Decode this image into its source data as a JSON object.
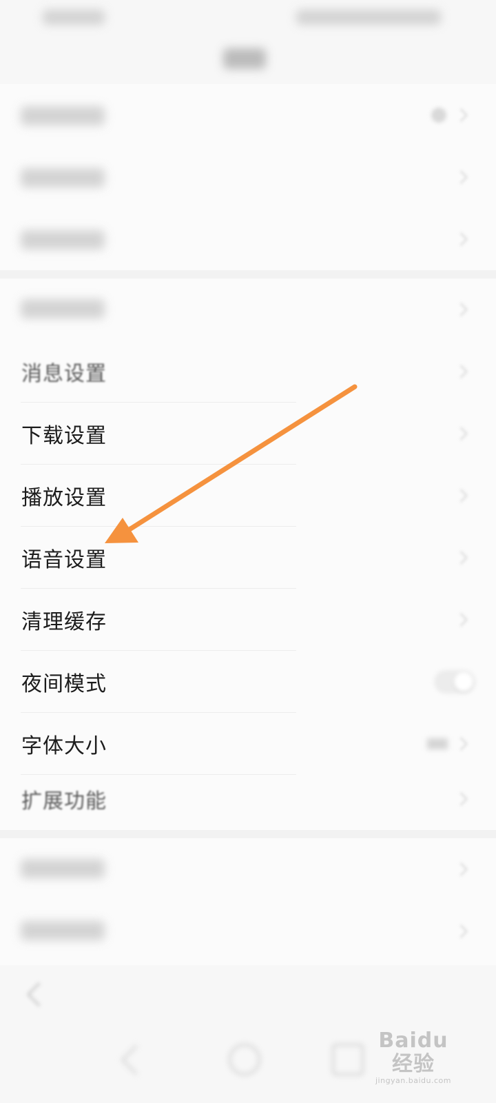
{
  "settings": {
    "section_1": [
      {
        "label": "",
        "blurred": true,
        "trailing": "badge"
      },
      {
        "label": "",
        "blurred": true,
        "trailing": "chevron"
      },
      {
        "label": "",
        "blurred": true,
        "trailing": "chevron"
      }
    ],
    "section_2": [
      {
        "label": "",
        "blurred": true,
        "trailing": "chevron"
      },
      {
        "label": "消息设置",
        "trailing": "chevron"
      },
      {
        "label": "下载设置",
        "trailing": "chevron"
      },
      {
        "label": "播放设置",
        "trailing": "chevron"
      },
      {
        "label": "语音设置",
        "trailing": "chevron"
      },
      {
        "label": "清理缓存",
        "trailing": "chevron"
      },
      {
        "label": "夜间模式",
        "trailing": "toggle",
        "toggle_on": false
      },
      {
        "label": "字体大小",
        "trailing": "value"
      },
      {
        "label": "扩展功能",
        "trailing": "chevron"
      }
    ],
    "section_3": [
      {
        "label": "",
        "blurred": true,
        "trailing": "chevron"
      },
      {
        "label": "",
        "blurred": true,
        "trailing": "chevron"
      }
    ]
  },
  "annotation": {
    "color": "#f5923e",
    "points_to": "语音设置"
  },
  "watermark": {
    "brand": "Baidu 经验",
    "url": "jingyan.baidu.com"
  },
  "icons": [
    "chevron-right-icon",
    "back-icon",
    "nav-back-icon",
    "nav-home-icon",
    "nav-recent-icon",
    "arrow-annotation-icon"
  ]
}
